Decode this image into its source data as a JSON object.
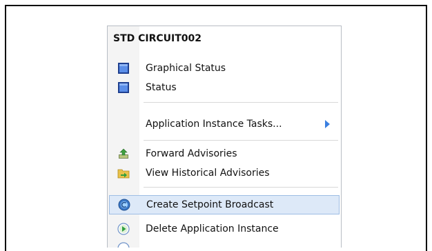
{
  "menu": {
    "header": "STD CIRCUIT002",
    "items": [
      {
        "label": "Graphical Status",
        "icon": "monitor-icon"
      },
      {
        "label": "Status",
        "icon": "monitor-icon"
      },
      {
        "label": "Application Instance Tasks...",
        "icon": "none",
        "submenu": true
      },
      {
        "label": "Forward Advisories",
        "icon": "forward-advisory-icon"
      },
      {
        "label": "View Historical Advisories",
        "icon": "folder-arrow-icon"
      },
      {
        "label": "Create Setpoint Broadcast",
        "icon": "broadcast-icon",
        "highlighted": true
      },
      {
        "label": "Delete Application Instance",
        "icon": "green-play-icon"
      }
    ]
  },
  "colors": {
    "highlight": "#dde9f8",
    "highlight_border": "#9dbde4",
    "submenu_arrow": "#3b7fe0",
    "monitor_icon": "#2f5fbf"
  }
}
